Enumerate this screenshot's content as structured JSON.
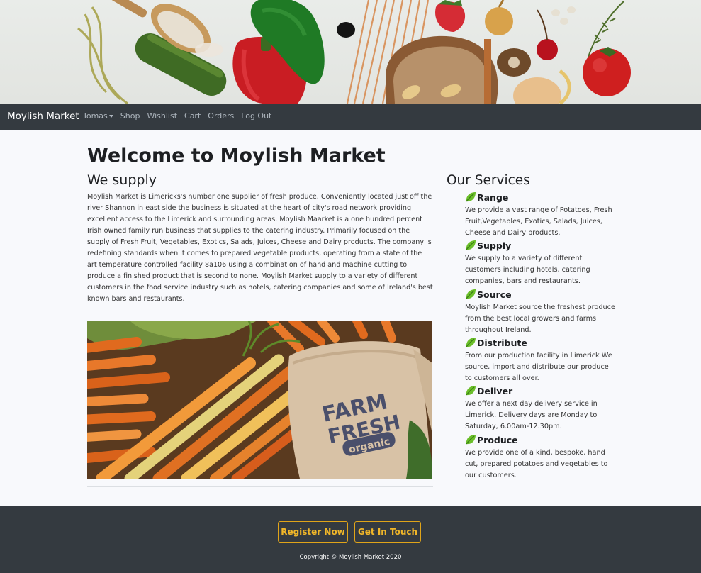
{
  "brand": "Moylish Market",
  "nav": {
    "user": "Tomas",
    "links": [
      "Shop",
      "Wishlist",
      "Cart",
      "Orders",
      "Log Out"
    ]
  },
  "main": {
    "title": "Welcome to Moylish Market",
    "subtitle": "We supply",
    "about": "Moylish Market is Limericks's number one supplier of fresh produce. Conveniently located just off the river Shannon in east side the business is situated at the heart of city's road network providing excellent access to the Limerick and surrounding areas. Moylish Maarket is a one hundred percent Irish owned family run business that supplies to the catering industry. Primarily focused on the supply of Fresh Fruit, Vegetables, Exotics, Salads, Juices, Cheese and Dairy products. The company is redefining standards when it comes to prepared vegetable products, operating from a state of the art temperature controlled facility 8a106 using a combination of hand and machine cutting to produce a finished product that is second to none. Moylish Market supply to a variety of different customers in the food service industry such as hotels, catering companies and some of Ireland's best known bars and restaurants.",
    "bag_text": [
      "FARM",
      "FRESH",
      "organic"
    ]
  },
  "services": {
    "heading": "Our Services",
    "items": [
      {
        "title": "Range",
        "text": "We provide a vast range of Potatoes, Fresh Fruit,Vegetables, Exotics, Salads, Juices, Cheese and Dairy products."
      },
      {
        "title": "Supply",
        "text": "We supply to a variety of different customers including hotels, catering companies, bars and restaurants."
      },
      {
        "title": "Source",
        "text": "Moylish Market source the freshest produce from the best local growers and farms throughout Ireland."
      },
      {
        "title": "Distribute",
        "text": "From our production facility in Limerick We source, import and distribute our produce to customers all over."
      },
      {
        "title": "Deliver",
        "text": "We offer a next day delivery service in Limerick. Delivery days are Monday to Saturday, 6.00am-12.30pm."
      },
      {
        "title": "Produce",
        "text": "We provide one of a kind, bespoke, hand cut, prepared potatoes and vegetables to our customers."
      }
    ]
  },
  "footer": {
    "register": "Register Now",
    "contact": "Get In Touch",
    "copyright": "Copyright © Moylish Market 2020"
  },
  "colors": {
    "navbar": "#343a40",
    "accent": "#f0b629",
    "leaf": "#6bbf2a"
  }
}
